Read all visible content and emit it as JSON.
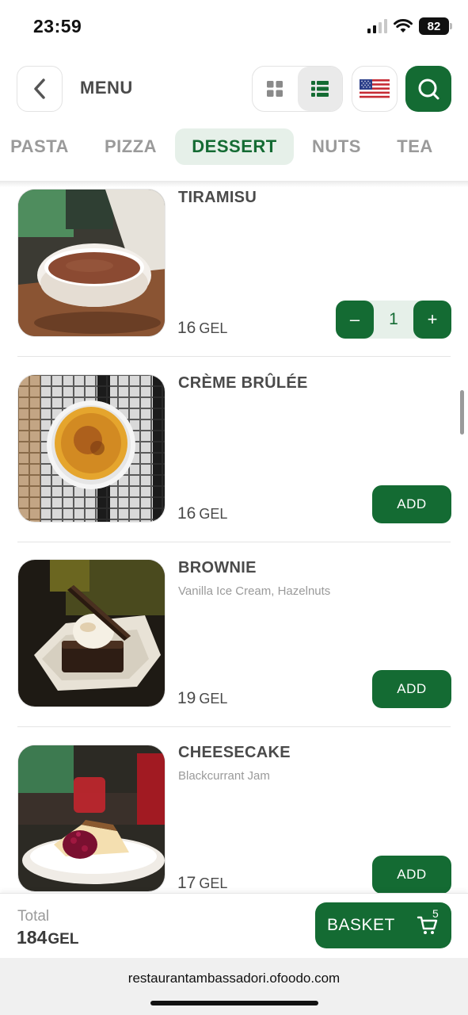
{
  "status_bar": {
    "time": "23:59",
    "battery": "82"
  },
  "header": {
    "title": "MENU"
  },
  "tabs": [
    {
      "label": "PASTA",
      "active": false
    },
    {
      "label": "PIZZA",
      "active": false
    },
    {
      "label": "DESSERT",
      "active": true
    },
    {
      "label": "NUTS",
      "active": false
    },
    {
      "label": "TEA",
      "active": false
    }
  ],
  "items": [
    {
      "name": "TIRAMISU",
      "description": "",
      "price": "16",
      "currency": "GEL",
      "quantity": "1",
      "minus": "–",
      "plus": "+"
    },
    {
      "name": "CRÈME BRÛLÉE",
      "description": "",
      "price": "16",
      "currency": "GEL",
      "add_label": "ADD"
    },
    {
      "name": "BROWNIE",
      "description": "Vanilla Ice Cream, Hazelnuts",
      "price": "19",
      "currency": "GEL",
      "add_label": "ADD"
    },
    {
      "name": "CHEESECAKE",
      "description": "Blackcurrant Jam",
      "price": "17",
      "currency": "GEL",
      "add_label": "ADD"
    }
  ],
  "footer": {
    "total_label": "Total",
    "total_value": "184",
    "total_currency": "GEL",
    "basket_label": "BASKET",
    "basket_count": "5"
  },
  "browser": {
    "url": "restaurantambassadori.ofoodo.com"
  },
  "colors": {
    "brand": "#146b33",
    "brand_tint": "#e6f0e9"
  },
  "icons": [
    "chevron-left-icon",
    "grid-icon",
    "list-icon",
    "us-flag-icon",
    "search-icon",
    "cart-icon",
    "wifi-icon",
    "signal-icon",
    "battery-icon"
  ]
}
